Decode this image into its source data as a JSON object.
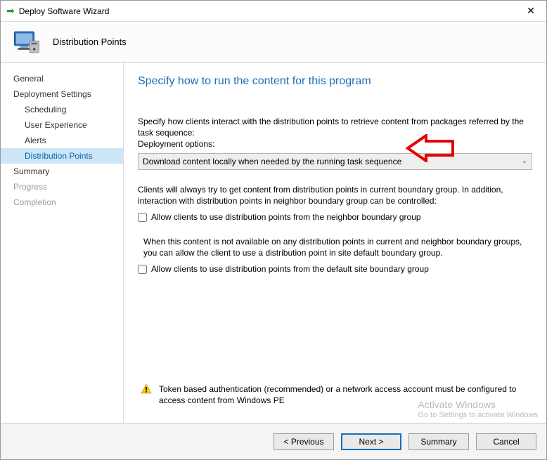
{
  "window": {
    "title": "Deploy Software Wizard"
  },
  "header": {
    "page_name": "Distribution Points"
  },
  "sidebar": {
    "items": [
      {
        "label": "General",
        "sub": false,
        "active": false,
        "disabled": false
      },
      {
        "label": "Deployment Settings",
        "sub": false,
        "active": false,
        "disabled": false
      },
      {
        "label": "Scheduling",
        "sub": true,
        "active": false,
        "disabled": false
      },
      {
        "label": "User Experience",
        "sub": true,
        "active": false,
        "disabled": false
      },
      {
        "label": "Alerts",
        "sub": true,
        "active": false,
        "disabled": false
      },
      {
        "label": "Distribution Points",
        "sub": true,
        "active": true,
        "disabled": false
      },
      {
        "label": "Summary",
        "sub": false,
        "active": false,
        "disabled": false
      },
      {
        "label": "Progress",
        "sub": false,
        "active": false,
        "disabled": true
      },
      {
        "label": "Completion",
        "sub": false,
        "active": false,
        "disabled": true
      }
    ]
  },
  "content": {
    "heading": "Specify how to run the content for this program",
    "intro": "Specify how clients interact with the distribution points to retrieve content from packages referred by the task sequence:",
    "options_label": "Deployment options:",
    "dropdown_value": "Download content locally when needed by the running task sequence",
    "boundary_text": "Clients will always try to get content from distribution points in current boundary group. In addition, interaction with distribution points in neighbor boundary group can be controlled:",
    "cb1_label": "Allow clients to use distribution points from the neighbor boundary group",
    "fallback_text": "When this content is not available on any distribution points in current and neighbor boundary groups, you can allow the client to use a distribution point in site default boundary group.",
    "cb2_label": "Allow clients to use distribution points from the default site boundary group",
    "warn_text": "Token based authentication (recommended) or a network access account must be configured to access content from Windows PE"
  },
  "footer": {
    "previous": "< Previous",
    "next": "Next >",
    "summary": "Summary",
    "cancel": "Cancel"
  },
  "watermark": {
    "line1": "Activate Windows",
    "line2": "Go to Settings to activate Windows"
  }
}
